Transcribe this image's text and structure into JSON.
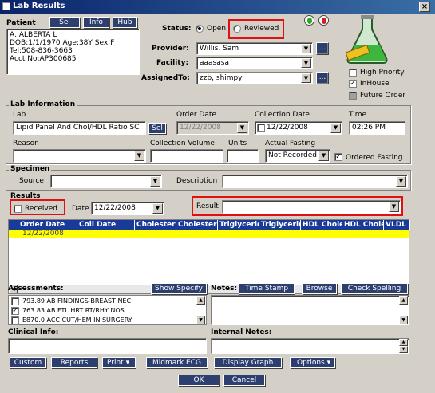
{
  "window": {
    "title": "Lab Results",
    "close": "×"
  },
  "patient": {
    "label": "Patient",
    "sel_btn": "Sel",
    "info_btn": "Info",
    "hub_btn": "Hub",
    "lines": [
      "A, ALBERTA L",
      "DOB:1/1/1970  Age:38Y  Sex:F",
      "Tel:508-836-3663",
      "Acct No:AP300685"
    ]
  },
  "status": {
    "label": "Status:",
    "open": "Open",
    "reviewed": "Reviewed",
    "selected": "Open"
  },
  "provider": {
    "label": "Provider:",
    "value": "Willis, Sam"
  },
  "facility": {
    "label": "Facility:",
    "value": "aaasasa"
  },
  "assigned": {
    "label": "AssignedTo:",
    "value": "zzb, shimpy"
  },
  "ellipsis": "...",
  "flags": {
    "high_priority": "High Priority",
    "inhouse": "InHouse",
    "future_order": "Future Order",
    "high_checked": false,
    "inhouse_checked": true,
    "future_checked": false
  },
  "lab_info": {
    "title": "Lab Information",
    "lab_label": "Lab",
    "lab_value": "Lipid Panel And Chol/HDL Ratio SC",
    "sel_btn": "Sel",
    "order_date_label": "Order Date",
    "order_date": "12/22/2008",
    "collection_date_label": "Collection Date",
    "collection_date": "12/22/2008",
    "time_label": "Time",
    "time": "02:26 PM",
    "reason_label": "Reason",
    "reason": "",
    "collection_volume_label": "Collection Volume",
    "collection_volume": "",
    "units_label": "Units",
    "units": "",
    "actual_fasting_label": "Actual Fasting",
    "actual_fasting": "Not Recorded",
    "ordered_fasting": "Ordered Fasting",
    "ordered_fasting_checked": true
  },
  "specimen": {
    "title": "Specimen",
    "source_label": "Source",
    "source": "",
    "description_label": "Description",
    "description": ""
  },
  "results": {
    "title": "Results",
    "received": "Received",
    "date_label": "Date",
    "date": "12/22/2008",
    "result_label": "Result",
    "result": "",
    "columns": [
      "Order Date",
      "Coll Date",
      "Cholesterol",
      "Cholesterol",
      "Triglyceride",
      "Triglyceride",
      "HDL Chole",
      "HDL Chole",
      "VLDL C"
    ],
    "rows": [
      [
        "12/22/2008",
        "",
        "",
        "",
        "",
        "",
        "",
        "",
        ""
      ]
    ]
  },
  "assessments": {
    "title": "Assessments:",
    "show_specify": "Show Specify",
    "items": [
      {
        "text": "793.89 AB FINDINGS-BREAST NEC",
        "checked": false
      },
      {
        "text": "763.83 AB FTL HRT RT/RHY NOS",
        "checked": true
      },
      {
        "text": "E870.0 ACC CUT/HEM IN SURGERY",
        "checked": false
      }
    ]
  },
  "notes": {
    "title": "Notes:",
    "time_stamp": "Time Stamp",
    "browse": "Browse",
    "check_spelling": "Check Spelling",
    "value": ""
  },
  "clinical_info": {
    "title": "Clinical Info:",
    "value": ""
  },
  "internal_notes": {
    "title": "Internal Notes:",
    "value": ""
  },
  "bottom_buttons": {
    "custom": "Custom",
    "reports": "Reports",
    "print": "Print",
    "midmark": "Midmark ECG",
    "display_graph": "Display Graph",
    "options": "Options"
  },
  "ok": "OK",
  "cancel": "Cancel"
}
